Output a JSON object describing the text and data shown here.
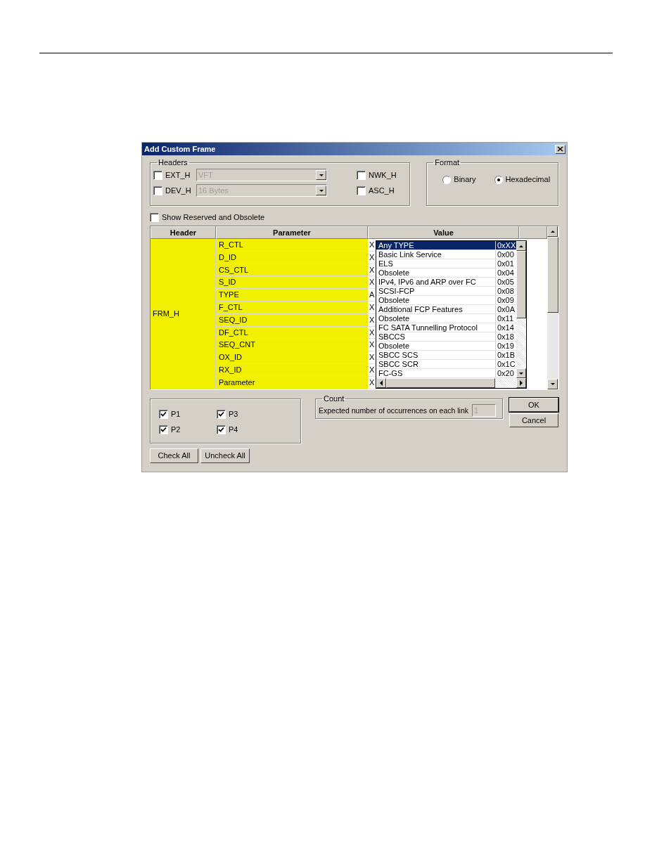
{
  "dialog": {
    "title": "Add Custom Frame",
    "headers": {
      "label": "Headers",
      "items": [
        {
          "label": "EXT_H",
          "checked": false,
          "combo": "VFT",
          "disabled": true
        },
        {
          "label": "NWK_H",
          "checked": false
        },
        {
          "label": "DEV_H",
          "checked": false,
          "combo": "16 Bytes",
          "disabled": true
        },
        {
          "label": "ASC_H",
          "checked": false
        }
      ]
    },
    "format": {
      "label": "Format",
      "options": [
        {
          "label": "Binary",
          "selected": false
        },
        {
          "label": "Hexadecimal",
          "selected": true
        }
      ]
    },
    "show_reserved": {
      "label": "Show Reserved and Obsolete",
      "checked": false
    },
    "table": {
      "columns": [
        "Header",
        "Parameter",
        "Value"
      ],
      "header_cell": "FRM_H",
      "rows": [
        {
          "parameter": "R_CTL",
          "value": "X"
        },
        {
          "parameter": "D_ID",
          "value": "X"
        },
        {
          "parameter": "CS_CTL",
          "value": "X"
        },
        {
          "parameter": "S_ID",
          "value": "X"
        },
        {
          "parameter": "TYPE",
          "value": "A"
        },
        {
          "parameter": "F_CTL",
          "value": "X"
        },
        {
          "parameter": "SEQ_ID",
          "value": "X"
        },
        {
          "parameter": "DF_CTL",
          "value": "X"
        },
        {
          "parameter": "SEQ_CNT",
          "value": "X"
        },
        {
          "parameter": "OX_ID",
          "value": "X"
        },
        {
          "parameter": "RX_ID",
          "value": "X"
        },
        {
          "parameter": "Parameter",
          "value": "X"
        }
      ]
    },
    "dropdown": {
      "items": [
        {
          "name": "Any TYPE",
          "code": "0xXX",
          "selected": true
        },
        {
          "name": "Basic Link Service",
          "code": "0x00",
          "selected": false
        },
        {
          "name": "ELS",
          "code": "0x01",
          "selected": false
        },
        {
          "name": "Obsolete",
          "code": "0x04",
          "selected": false
        },
        {
          "name": "IPv4, IPv6 and ARP over FC",
          "code": "0x05",
          "selected": false
        },
        {
          "name": "SCSI-FCP",
          "code": "0x08",
          "selected": false
        },
        {
          "name": "Obsolete",
          "code": "0x09",
          "selected": false
        },
        {
          "name": "Additional FCP Features",
          "code": "0x0A",
          "selected": false
        },
        {
          "name": "Obsolete",
          "code": "0x11",
          "selected": false
        },
        {
          "name": "FC SATA Tunnelling Protocol",
          "code": "0x14",
          "selected": false
        },
        {
          "name": "SBCCS",
          "code": "0x18",
          "selected": false
        },
        {
          "name": "Obsolete",
          "code": "0x19",
          "selected": false
        },
        {
          "name": "SBCC SCS",
          "code": "0x1B",
          "selected": false
        },
        {
          "name": "SBCC SCR",
          "code": "0x1C",
          "selected": false
        },
        {
          "name": "FC-GS",
          "code": "0x20",
          "selected": false
        }
      ]
    },
    "ports": [
      {
        "label": "P1",
        "checked": true
      },
      {
        "label": "P2",
        "checked": true
      },
      {
        "label": "P3",
        "checked": true
      },
      {
        "label": "P4",
        "checked": true
      }
    ],
    "count": {
      "label": "Count",
      "text": "Expected number of occurrences on each link",
      "value": "1",
      "disabled": true
    },
    "buttons": [
      "OK",
      "Cancel"
    ],
    "bottom_buttons": [
      "Check All",
      "Uncheck All"
    ]
  }
}
